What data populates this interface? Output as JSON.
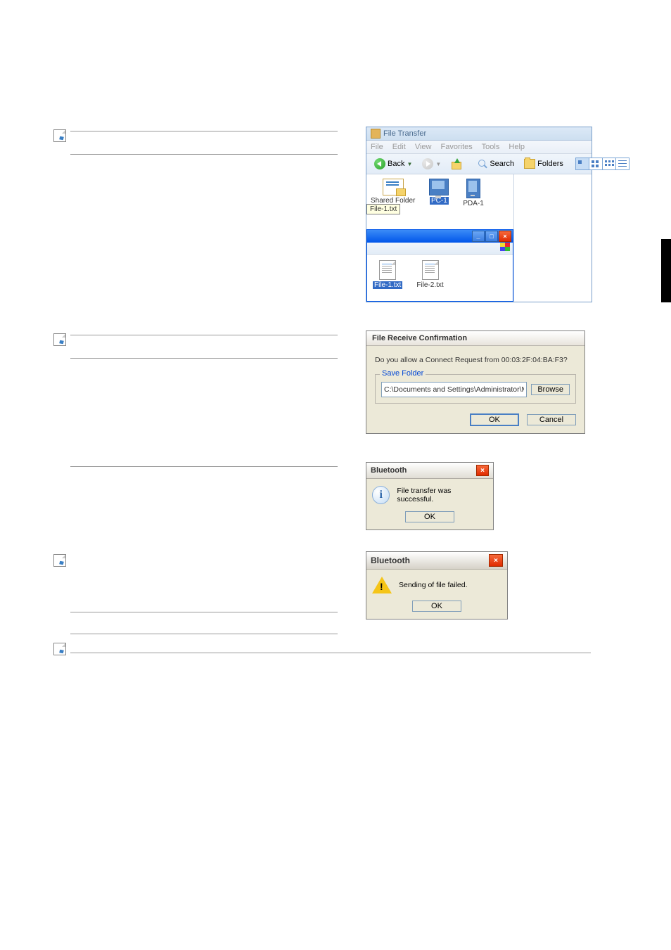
{
  "file_transfer": {
    "title": "File Transfer",
    "menu": [
      "File",
      "Edit",
      "View",
      "Favorites",
      "Tools",
      "Help"
    ],
    "toolbar": {
      "back": "Back",
      "search": "Search",
      "folders": "Folders"
    },
    "items": [
      {
        "label": "Shared Folder",
        "type": "shared"
      },
      {
        "label": "PC-1",
        "type": "pc",
        "selected": true
      },
      {
        "label": "PDA-1",
        "type": "pda"
      }
    ],
    "tooltip": "File-1.txt",
    "files": [
      {
        "label": "File-1.txt",
        "selected": true
      },
      {
        "label": "File-2.txt",
        "selected": false
      }
    ]
  },
  "file_receive": {
    "title": "File Receive Confirmation",
    "message": "Do you allow a Connect Request from 00:03:2F:04:BA:F3?",
    "save_folder_label": "Save Folder",
    "path": "C:\\Documents and Settings\\Administrator\\My Documents",
    "browse": "Browse",
    "ok": "OK",
    "cancel": "Cancel"
  },
  "bt_success": {
    "title": "Bluetooth",
    "message": "File transfer was successful.",
    "ok": "OK"
  },
  "bt_fail": {
    "title": "Bluetooth",
    "message": "Sending of file failed.",
    "ok": "OK"
  }
}
